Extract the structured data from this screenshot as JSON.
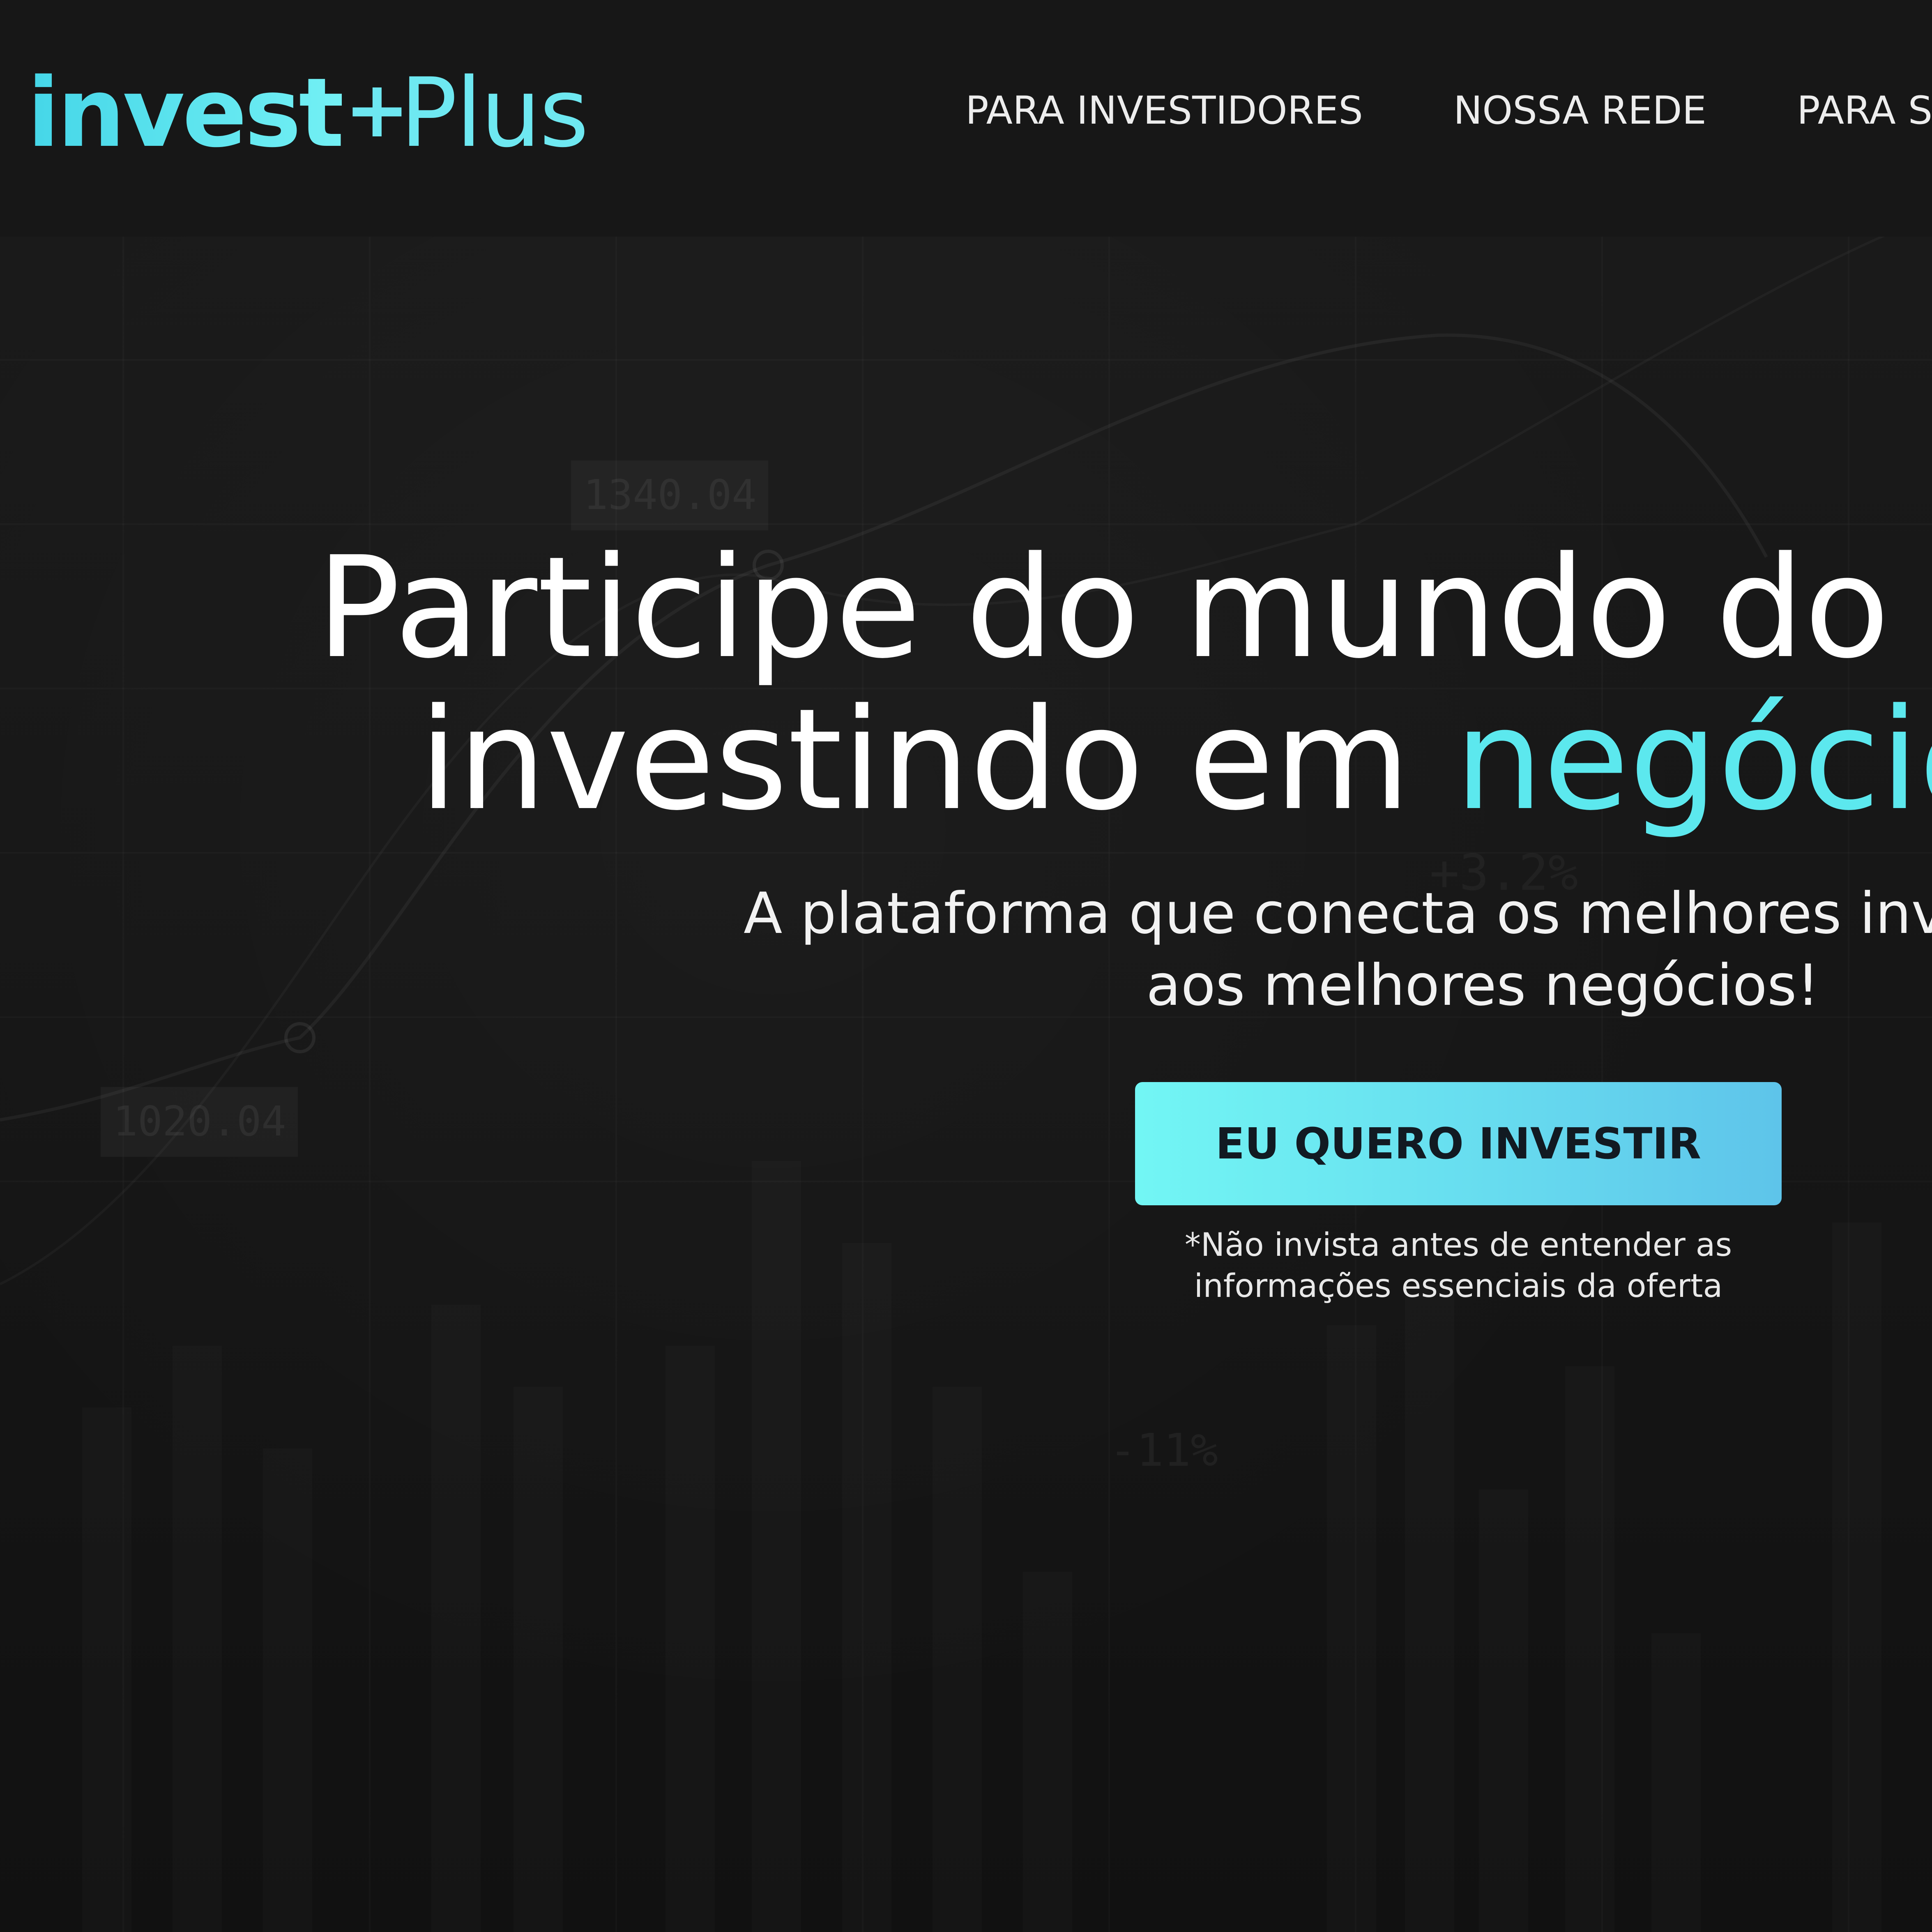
{
  "header": {
    "logo": {
      "invest": "invest",
      "plus": "Plus"
    },
    "nav": [
      {
        "label": "PARA INVESTIDORES"
      },
      {
        "label": "NOSSA REDE"
      },
      {
        "label": "PARA START"
      }
    ]
  },
  "hero": {
    "headline_line1": "Participe do mundo do Vent",
    "headline_line2_prefix": "investindo em ",
    "headline_line2_highlight": "negócios d",
    "subtitle_line1": "A plataforma que conecta os melhores inves",
    "subtitle_line2": "aos melhores negócios!",
    "cta_label": "EU QUERO INVESTIR",
    "disclaimer_line1": "*Não invista antes de entender as",
    "disclaimer_line2": "informações essenciais da oferta"
  },
  "background": {
    "labels": [
      "1340.04",
      "1020.04",
      "-11%",
      "+3.2%"
    ]
  },
  "colors": {
    "accent": "#5ce8ee",
    "background": "#141414",
    "cta_gradient_start": "#72f6f4",
    "cta_gradient_end": "#5ec4ea",
    "text": "#ffffff"
  }
}
